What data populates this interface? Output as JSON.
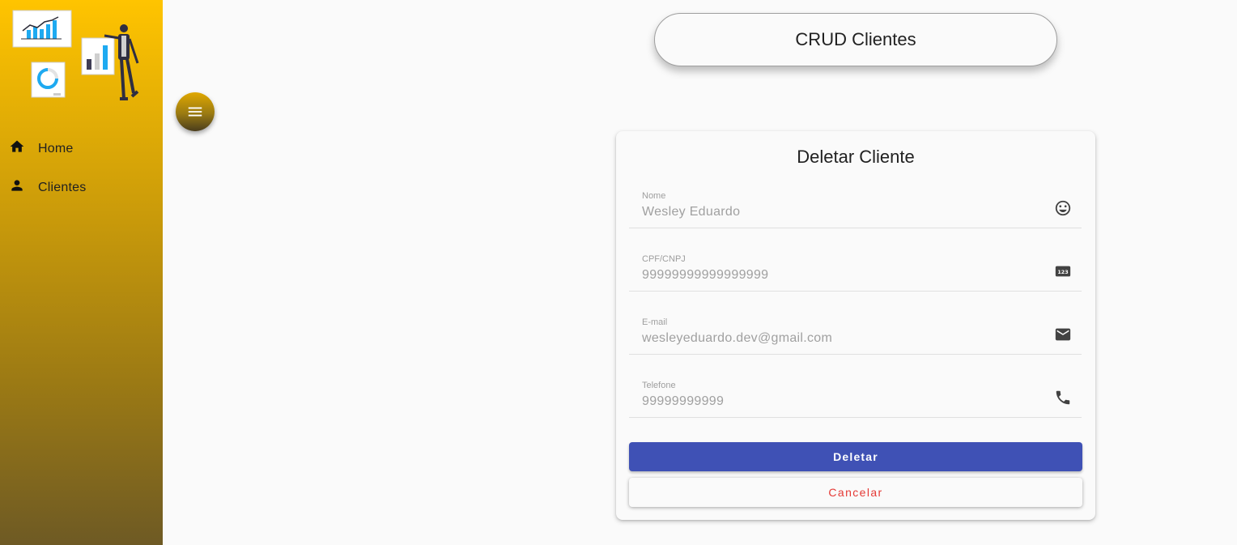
{
  "app": {
    "title": "CRUD Clientes"
  },
  "sidebar": {
    "items": [
      {
        "label": "Home",
        "icon": "home-icon"
      },
      {
        "label": "Clientes",
        "icon": "person-icon"
      }
    ]
  },
  "menu_button": {
    "icon": "menu-icon"
  },
  "form": {
    "title": "Deletar Cliente",
    "fields": [
      {
        "label": "Nome",
        "value": "Wesley Eduardo",
        "icon": "smiley-face-icon"
      },
      {
        "label": "CPF/CNPJ",
        "value": "99999999999999999",
        "icon": "numbers-123-icon"
      },
      {
        "label": "E-mail",
        "value": "wesleyeduardo.dev@gmail.com",
        "icon": "mail-icon"
      },
      {
        "label": "Telefone",
        "value": "99999999999",
        "icon": "phone-icon"
      }
    ],
    "delete_label": "Deletar",
    "cancel_label": "Cancelar"
  },
  "colors": {
    "sidebar_top": "#ffc400",
    "sidebar_bottom": "#6e5a24",
    "primary": "#3f51b5",
    "warn": "#e53935",
    "chart_accent": "#1eaaf1"
  }
}
